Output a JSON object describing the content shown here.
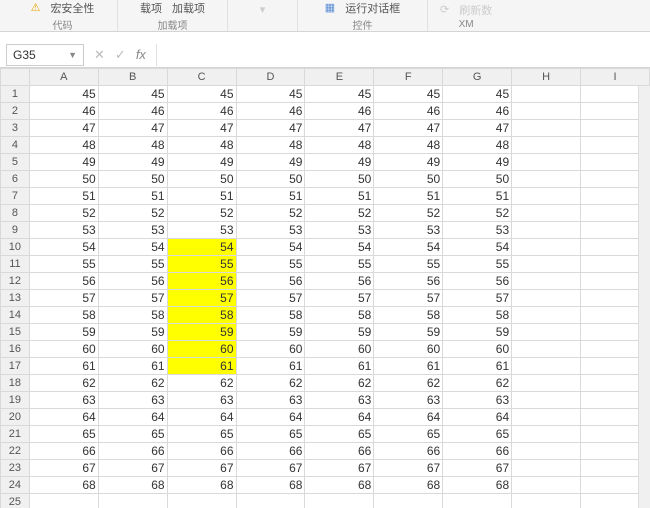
{
  "ribbon": {
    "macro_security": "宏安全性",
    "code_label": "代码",
    "cai_xiang": "载项",
    "jia_zai_xiang": "加载项",
    "addins_label": "加载项",
    "run_dialog": "运行对话框",
    "controls_label": "控件",
    "shuaxin": "刷新数",
    "xm": "XM"
  },
  "formula_bar": {
    "name_box": "G35",
    "input_value": ""
  },
  "columns": [
    "A",
    "B",
    "C",
    "D",
    "E",
    "F",
    "G",
    "H",
    "I"
  ],
  "rows": [
    {
      "r": 1,
      "c": [
        45,
        45,
        45,
        45,
        45,
        45,
        45,
        "",
        ""
      ]
    },
    {
      "r": 2,
      "c": [
        46,
        46,
        46,
        46,
        46,
        46,
        46,
        "",
        ""
      ]
    },
    {
      "r": 3,
      "c": [
        47,
        47,
        47,
        47,
        47,
        47,
        47,
        "",
        ""
      ]
    },
    {
      "r": 4,
      "c": [
        48,
        48,
        48,
        48,
        48,
        48,
        48,
        "",
        ""
      ]
    },
    {
      "r": 5,
      "c": [
        49,
        49,
        49,
        49,
        49,
        49,
        49,
        "",
        ""
      ]
    },
    {
      "r": 6,
      "c": [
        50,
        50,
        50,
        50,
        50,
        50,
        50,
        "",
        ""
      ]
    },
    {
      "r": 7,
      "c": [
        51,
        51,
        51,
        51,
        51,
        51,
        51,
        "",
        ""
      ]
    },
    {
      "r": 8,
      "c": [
        52,
        52,
        52,
        52,
        52,
        52,
        52,
        "",
        ""
      ]
    },
    {
      "r": 9,
      "c": [
        53,
        53,
        53,
        53,
        53,
        53,
        53,
        "",
        ""
      ]
    },
    {
      "r": 10,
      "c": [
        54,
        54,
        54,
        54,
        54,
        54,
        54,
        "",
        ""
      ]
    },
    {
      "r": 11,
      "c": [
        55,
        55,
        55,
        55,
        55,
        55,
        55,
        "",
        ""
      ]
    },
    {
      "r": 12,
      "c": [
        56,
        56,
        56,
        56,
        56,
        56,
        56,
        "",
        ""
      ]
    },
    {
      "r": 13,
      "c": [
        57,
        57,
        57,
        57,
        57,
        57,
        57,
        "",
        ""
      ]
    },
    {
      "r": 14,
      "c": [
        58,
        58,
        58,
        58,
        58,
        58,
        58,
        "",
        ""
      ]
    },
    {
      "r": 15,
      "c": [
        59,
        59,
        59,
        59,
        59,
        59,
        59,
        "",
        ""
      ]
    },
    {
      "r": 16,
      "c": [
        60,
        60,
        60,
        60,
        60,
        60,
        60,
        "",
        ""
      ]
    },
    {
      "r": 17,
      "c": [
        61,
        61,
        61,
        61,
        61,
        61,
        61,
        "",
        ""
      ]
    },
    {
      "r": 18,
      "c": [
        62,
        62,
        62,
        62,
        62,
        62,
        62,
        "",
        ""
      ]
    },
    {
      "r": 19,
      "c": [
        63,
        63,
        63,
        63,
        63,
        63,
        63,
        "",
        ""
      ]
    },
    {
      "r": 20,
      "c": [
        64,
        64,
        64,
        64,
        64,
        64,
        64,
        "",
        ""
      ]
    },
    {
      "r": 21,
      "c": [
        65,
        65,
        65,
        65,
        65,
        65,
        65,
        "",
        ""
      ]
    },
    {
      "r": 22,
      "c": [
        66,
        66,
        66,
        66,
        66,
        66,
        66,
        "",
        ""
      ]
    },
    {
      "r": 23,
      "c": [
        67,
        67,
        67,
        67,
        67,
        67,
        67,
        "",
        ""
      ]
    },
    {
      "r": 24,
      "c": [
        68,
        68,
        68,
        68,
        68,
        68,
        68,
        "",
        ""
      ]
    },
    {
      "r": 25,
      "c": [
        "",
        "",
        "",
        "",
        "",
        "",
        "",
        "",
        ""
      ]
    }
  ],
  "highlight": {
    "col": 2,
    "rowStart": 10,
    "rowEnd": 17
  }
}
